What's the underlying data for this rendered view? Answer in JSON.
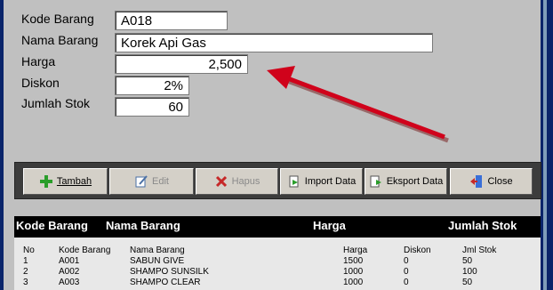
{
  "form": {
    "kode_label": "Kode Barang",
    "kode_value": "A018",
    "nama_label": "Nama Barang",
    "nama_value": "Korek Api Gas",
    "harga_label": "Harga",
    "harga_value": "2,500",
    "diskon_label": "Diskon",
    "diskon_value": "2%",
    "stok_label": "Jumlah Stok",
    "stok_value": "60"
  },
  "toolbar": {
    "tambah": "Tambah",
    "edit": "Edit",
    "hapus": "Hapus",
    "import": "Import Data",
    "eksport": "Eksport Data",
    "close": "Close"
  },
  "header": {
    "kode": "Kode Barang",
    "nama": "Nama Barang",
    "harga": "Harga",
    "stok": "Jumlah Stok"
  },
  "table": {
    "columns": [
      "No",
      "Kode Barang",
      "Nama Barang",
      "Harga",
      "Diskon",
      "Jml Stok"
    ],
    "rows": [
      [
        "1",
        "A001",
        "SABUN GIVE",
        "1500",
        "0",
        "50"
      ],
      [
        "2",
        "A002",
        "SHAMPO SUNSILK",
        "1000",
        "0",
        "100"
      ],
      [
        "3",
        "A003",
        "SHAMPO CLEAR",
        "1000",
        "0",
        "50"
      ]
    ]
  },
  "colors": {
    "arrow": "#d0021b",
    "toolbar_bg": "#3c3c3c",
    "window_bg": "#c0c0c0"
  }
}
